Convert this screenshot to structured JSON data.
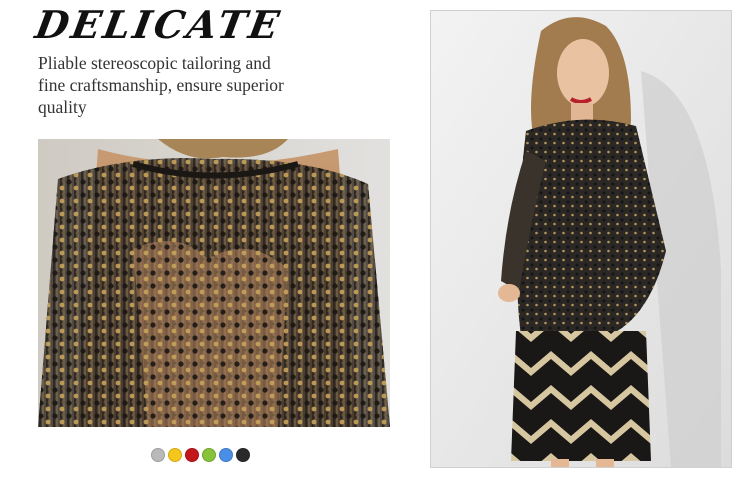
{
  "heading": {
    "title": "DELICATE",
    "description": "Pliable stereoscopic tailoring and fine craftsmanship, ensure superior quality"
  },
  "swatches": [
    {
      "color": "#b9b9b9"
    },
    {
      "color": "#f6c71b"
    },
    {
      "color": "#c3161c"
    },
    {
      "color": "#86c23a"
    },
    {
      "color": "#4a8fe7"
    },
    {
      "color": "#2a2a2a"
    }
  ]
}
